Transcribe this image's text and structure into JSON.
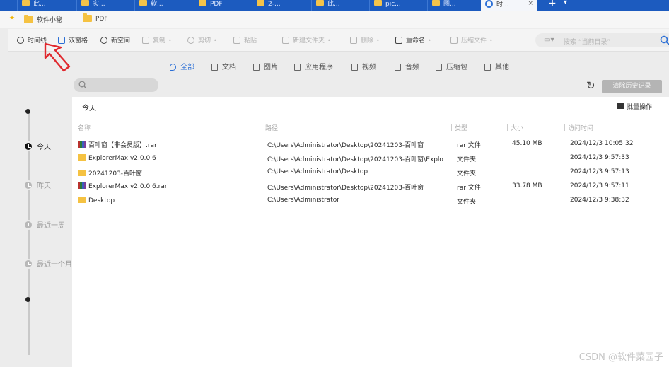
{
  "tabs": [
    {
      "label": "此..."
    },
    {
      "label": "实..."
    },
    {
      "label": "软..."
    },
    {
      "label": "PDF"
    },
    {
      "label": "2-..."
    },
    {
      "label": "此..."
    },
    {
      "label": "pic..."
    },
    {
      "label": "图..."
    },
    {
      "label": "时..."
    }
  ],
  "tab_actions": {
    "new": "+",
    "menu": "▾",
    "close": "×"
  },
  "bookmarks": {
    "star": "★",
    "items": [
      {
        "label": "软件小秘"
      },
      {
        "label": "PDF"
      }
    ]
  },
  "toolbar": {
    "timeline": "时间线",
    "dual_pane": "双窗格",
    "new_space": "新空间",
    "copy": "复制",
    "cut": "剪切",
    "paste": "粘贴",
    "new_folder": "新建文件夹",
    "delete": "删除",
    "rename": "重命名",
    "compress": "压缩文件",
    "search_placeholder": "搜索 “当前目录”"
  },
  "categories": [
    {
      "label": "全部"
    },
    {
      "label": "文档"
    },
    {
      "label": "图片"
    },
    {
      "label": "应用程序"
    },
    {
      "label": "视频"
    },
    {
      "label": "音频"
    },
    {
      "label": "压缩包"
    },
    {
      "label": "其他"
    }
  ],
  "timeline": [
    {
      "label": "今天"
    },
    {
      "label": "昨天"
    },
    {
      "label": "最近一周"
    },
    {
      "label": "最近一个月"
    }
  ],
  "actions": {
    "refresh": "↻",
    "clear_history": "清除历史记录",
    "batch": "批量操作"
  },
  "group_title": "今天",
  "columns": [
    "名称",
    "路径",
    "类型",
    "大小",
    "访问时间"
  ],
  "rows": [
    {
      "name": "百叶窗【非会员版】.rar",
      "path": "C:\\Users\\Administrator\\Desktop\\20241203-百叶窗",
      "type": "rar 文件",
      "size": "45.10 MB",
      "time": "2024/12/3 10:05:32",
      "icon": "rar-icon"
    },
    {
      "name": "ExplorerMax v2.0.0.6",
      "path": "C:\\Users\\Administrator\\Desktop\\20241203-百叶窗\\Explo",
      "type": "文件夹",
      "size": "",
      "time": "2024/12/3 9:57:33",
      "icon": "folder-icon"
    },
    {
      "name": "20241203-百叶窗",
      "path": "C:\\Users\\Administrator\\Desktop",
      "type": "文件夹",
      "size": "",
      "time": "2024/12/3 9:57:13",
      "icon": "folder-icon"
    },
    {
      "name": "ExplorerMax v2.0.0.6.rar",
      "path": "C:\\Users\\Administrator\\Desktop\\20241203-百叶窗",
      "type": "rar 文件",
      "size": "33.78 MB",
      "time": "2024/12/3 9:57:11",
      "icon": "rar-icon"
    },
    {
      "name": "Desktop",
      "path": "C:\\Users\\Administrator",
      "type": "文件夹",
      "size": "",
      "time": "2024/12/3 9:38:32",
      "icon": "folder-icon"
    }
  ],
  "watermark": "CSDN @软件菜园子",
  "colors": {
    "accent": "#2b6fd6",
    "tabbar": "#1c5bbf",
    "annotation": "#e0282e"
  }
}
